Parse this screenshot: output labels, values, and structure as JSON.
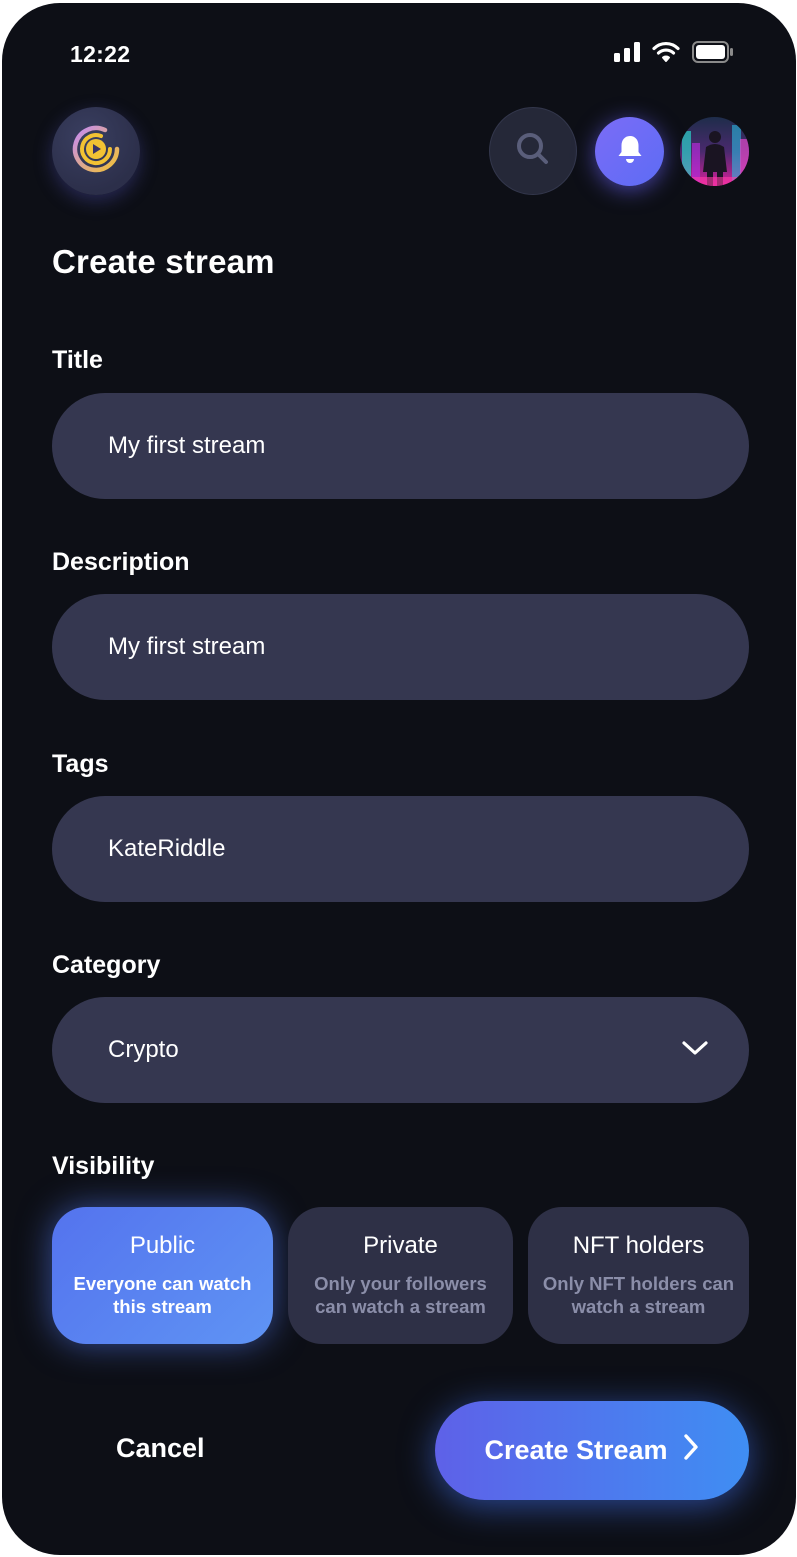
{
  "status_bar": {
    "time": "12:22",
    "signal_icon": "signal-bars-icon",
    "wifi_icon": "wifi-icon",
    "battery_icon": "battery-icon"
  },
  "header": {
    "logo_icon": "play-logo-icon",
    "search_icon": "search-icon",
    "notification_icon": "bell-icon",
    "avatar": "user-avatar"
  },
  "page": {
    "title": "Create stream"
  },
  "form": {
    "title": {
      "label": "Title",
      "value": "My first stream"
    },
    "description": {
      "label": "Description",
      "value": "My first stream"
    },
    "tags": {
      "label": "Tags",
      "value": "KateRiddle"
    },
    "category": {
      "label": "Category",
      "value": "Crypto",
      "icon": "chevron-down-icon"
    }
  },
  "visibility": {
    "label": "Visibility",
    "options": [
      {
        "title": "Public",
        "description": "Everyone can watch this stream",
        "selected": true
      },
      {
        "title": "Private",
        "description": "Only your followers can watch a stream",
        "selected": false
      },
      {
        "title": "NFT holders",
        "description": "Only NFT holders can watch a stream",
        "selected": false
      }
    ]
  },
  "actions": {
    "cancel_label": "Cancel",
    "create_label": "Create Stream",
    "create_icon": "chevron-right-icon"
  },
  "colors": {
    "background": "#0d0f16",
    "field": "#353750",
    "accent_start": "#5e61e8",
    "accent_end": "#3f8ef3",
    "bell": "#6b6cf6"
  }
}
